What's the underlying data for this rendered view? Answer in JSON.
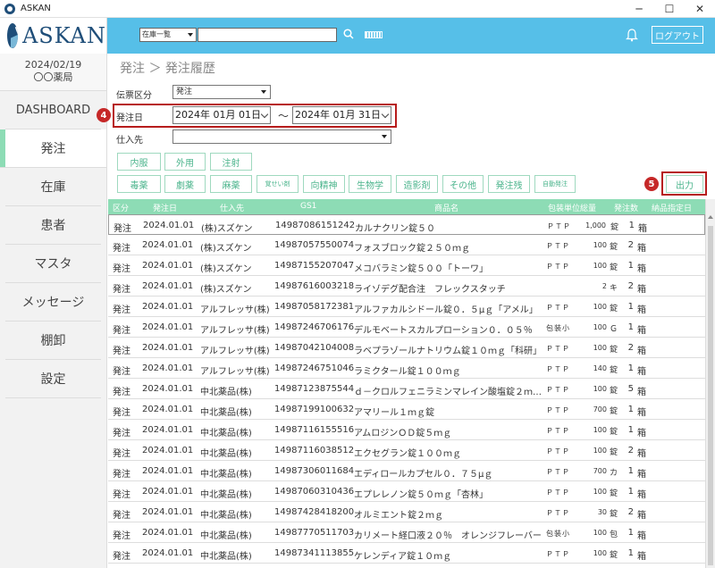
{
  "window": {
    "title": "ASKAN",
    "min": "─",
    "max": "☐",
    "close": "✕"
  },
  "sidebar": {
    "logo": "ASKAN",
    "date": "2024/02/19",
    "store": "〇〇薬局",
    "items": [
      {
        "label": "DASHBOARD"
      },
      {
        "label": "発注"
      },
      {
        "label": "在庫"
      },
      {
        "label": "患者"
      },
      {
        "label": "マスタ"
      },
      {
        "label": "メッセージ"
      },
      {
        "label": "棚卸"
      },
      {
        "label": "設定"
      }
    ]
  },
  "header": {
    "search_select": "在庫一覧",
    "logout": "ログアウト"
  },
  "breadcrumb": "発注 ＞ 発注履歴",
  "filters": {
    "slip_label": "伝票区分",
    "slip_value": "発注",
    "date_label": "発注日",
    "date_from": "2024年 01月 01日",
    "tilde": "～",
    "date_to": "2024年 01月 31日",
    "supplier_label": "仕入先",
    "supplier_value": ""
  },
  "markers": {
    "m4": "4",
    "m5": "5"
  },
  "buttons_row1": [
    "内服",
    "外用",
    "注射"
  ],
  "buttons_row2": [
    "毒薬",
    "劇薬",
    "麻薬",
    "覚せい剤",
    "向精神",
    "生物学",
    "造影剤",
    "その他",
    "発注残",
    "自動発注"
  ],
  "export_label": "出力",
  "columns": [
    "区分",
    "発注日",
    "仕入先",
    "GS1",
    "商品名",
    "包装単位総量",
    "発注数",
    "納品指定日"
  ],
  "rows": [
    {
      "kind": "発注",
      "date": "2024.01.01",
      "supplier": "(株)スズケン",
      "gs1": "14987086151242",
      "name": "カルナクリン錠５０",
      "pkg": "ＰＴＰ",
      "qty": "1,000",
      "unit": "錠",
      "count": "1",
      "box": "箱"
    },
    {
      "kind": "発注",
      "date": "2024.01.01",
      "supplier": "(株)スズケン",
      "gs1": "14987057550074",
      "name": "フォスブロック錠２５０ｍｇ",
      "pkg": "ＰＴＰ",
      "qty": "100",
      "unit": "錠",
      "count": "2",
      "box": "箱"
    },
    {
      "kind": "発注",
      "date": "2024.01.01",
      "supplier": "(株)スズケン",
      "gs1": "14987155207047",
      "name": "メコバラミン錠５００「トーワ」",
      "pkg": "ＰＴＰ",
      "qty": "100",
      "unit": "錠",
      "count": "1",
      "box": "箱"
    },
    {
      "kind": "発注",
      "date": "2024.01.01",
      "supplier": "(株)スズケン",
      "gs1": "14987616003218",
      "name": "ライゾデグ配合注　フレックスタッチ",
      "pkg": "",
      "qty": "2",
      "unit": "キ",
      "count": "2",
      "box": "箱"
    },
    {
      "kind": "発注",
      "date": "2024.01.01",
      "supplier": "アルフレッサ(株)",
      "gs1": "14987058172381",
      "name": "アルファカルシドール錠０．５μｇ「アメル」",
      "pkg": "ＰＴＰ",
      "qty": "100",
      "unit": "錠",
      "count": "1",
      "box": "箱"
    },
    {
      "kind": "発注",
      "date": "2024.01.01",
      "supplier": "アルフレッサ(株)",
      "gs1": "14987246706176",
      "name": "デルモベートスカルプローション０．０５％",
      "pkg": "包装小",
      "qty": "100",
      "unit": "Ｇ",
      "count": "1",
      "box": "箱"
    },
    {
      "kind": "発注",
      "date": "2024.01.01",
      "supplier": "アルフレッサ(株)",
      "gs1": "14987042104008",
      "name": "ラベプラゾールナトリウム錠１０ｍｇ「科研」",
      "pkg": "ＰＴＰ",
      "qty": "100",
      "unit": "錠",
      "count": "2",
      "box": "箱"
    },
    {
      "kind": "発注",
      "date": "2024.01.01",
      "supplier": "アルフレッサ(株)",
      "gs1": "14987246751046",
      "name": "ラミクタール錠１００ｍｇ",
      "pkg": "ＰＴＰ",
      "qty": "140",
      "unit": "錠",
      "count": "1",
      "box": "箱"
    },
    {
      "kind": "発注",
      "date": "2024.01.01",
      "supplier": "中北薬品(株)",
      "gs1": "14987123875544",
      "name": "ｄ－クロルフェニラミンマレイン酸塩錠２ｍｇ「…",
      "pkg": "ＰＴＰ",
      "qty": "100",
      "unit": "錠",
      "count": "5",
      "box": "箱"
    },
    {
      "kind": "発注",
      "date": "2024.01.01",
      "supplier": "中北薬品(株)",
      "gs1": "14987199100632",
      "name": "アマリール１ｍｇ錠",
      "pkg": "ＰＴＰ",
      "qty": "700",
      "unit": "錠",
      "count": "1",
      "box": "箱"
    },
    {
      "kind": "発注",
      "date": "2024.01.01",
      "supplier": "中北薬品(株)",
      "gs1": "14987116155516",
      "name": "アムロジンＯＤ錠５ｍｇ",
      "pkg": "ＰＴＰ",
      "qty": "100",
      "unit": "錠",
      "count": "1",
      "box": "箱"
    },
    {
      "kind": "発注",
      "date": "2024.01.01",
      "supplier": "中北薬品(株)",
      "gs1": "14987116038512",
      "name": "エクセグラン錠１００ｍｇ",
      "pkg": "ＰＴＰ",
      "qty": "100",
      "unit": "錠",
      "count": "2",
      "box": "箱"
    },
    {
      "kind": "発注",
      "date": "2024.01.01",
      "supplier": "中北薬品(株)",
      "gs1": "14987306011684",
      "name": "エディロールカプセル０．７５μｇ",
      "pkg": "ＰＴＰ",
      "qty": "700",
      "unit": "カ",
      "count": "1",
      "box": "箱"
    },
    {
      "kind": "発注",
      "date": "2024.01.01",
      "supplier": "中北薬品(株)",
      "gs1": "14987060310436",
      "name": "エプレレノン錠５０ｍｇ「杏林」",
      "pkg": "ＰＴＰ",
      "qty": "100",
      "unit": "錠",
      "count": "1",
      "box": "箱"
    },
    {
      "kind": "発注",
      "date": "2024.01.01",
      "supplier": "中北薬品(株)",
      "gs1": "14987428418200",
      "name": "オルミエント錠２ｍｇ",
      "pkg": "ＰＴＰ",
      "qty": "30",
      "unit": "錠",
      "count": "2",
      "box": "箱"
    },
    {
      "kind": "発注",
      "date": "2024.01.01",
      "supplier": "中北薬品(株)",
      "gs1": "14987770511703",
      "name": "カリメート経口液２０％　オレンジフレーバー",
      "pkg": "包装小",
      "qty": "100",
      "unit": "包",
      "count": "1",
      "box": "箱"
    },
    {
      "kind": "発注",
      "date": "2024.01.01",
      "supplier": "中北薬品(株)",
      "gs1": "14987341113855",
      "name": "ケレンディア錠１０ｍｇ",
      "pkg": "ＰＴＰ",
      "qty": "100",
      "unit": "錠",
      "count": "1",
      "box": "箱"
    }
  ]
}
